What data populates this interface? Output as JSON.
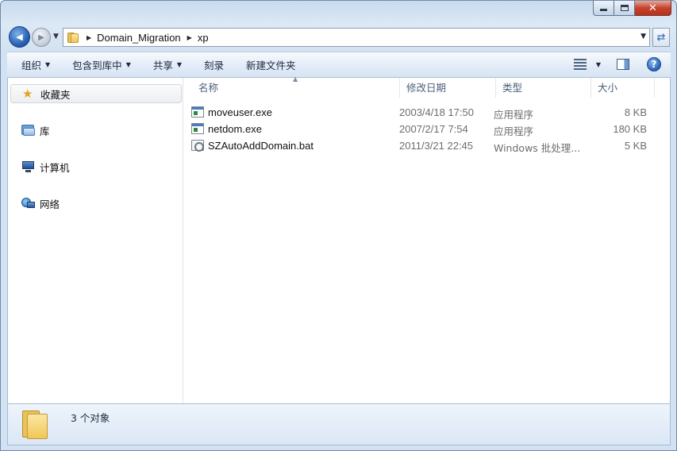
{
  "window": {
    "caption_close": "✕"
  },
  "nav": {
    "back_glyph": "◀",
    "forward_glyph": "▶",
    "dropdown_glyph": "▼",
    "address": [
      "Domain_Migration",
      "xp"
    ],
    "address_separator": "▶",
    "refresh_glyph": "⇄"
  },
  "toolbar": {
    "organize": "组织",
    "include_in_library": "包含到库中",
    "share": "共享",
    "burn": "刻录",
    "new_folder": "新建文件夹",
    "dropdown_glyph": "▼",
    "help": "?"
  },
  "navpane": {
    "favorites": "收藏夹",
    "libraries": "库",
    "computer": "计算机",
    "network": "网络"
  },
  "columns": {
    "name": "名称",
    "date_modified": "修改日期",
    "type": "类型",
    "size": "大小",
    "sort_caret": "▲"
  },
  "files": [
    {
      "name": "moveuser.exe",
      "date": "2003/4/18 17:50",
      "type": "应用程序",
      "size": "8 KB",
      "icon": "exe-icon"
    },
    {
      "name": "netdom.exe",
      "date": "2007/2/17 7:54",
      "type": "应用程序",
      "size": "180 KB",
      "icon": "exe-icon"
    },
    {
      "name": "SZAutoAddDomain.bat",
      "date": "2011/3/21 22:45",
      "type": "Windows 批处理...",
      "size": "5 KB",
      "icon": "bat-icon"
    }
  ],
  "status": {
    "count_text": "3 个对象"
  },
  "colors": {
    "accent": "#2a63b5",
    "close_red": "#c7432d",
    "folder_yellow": "#f0c757"
  }
}
